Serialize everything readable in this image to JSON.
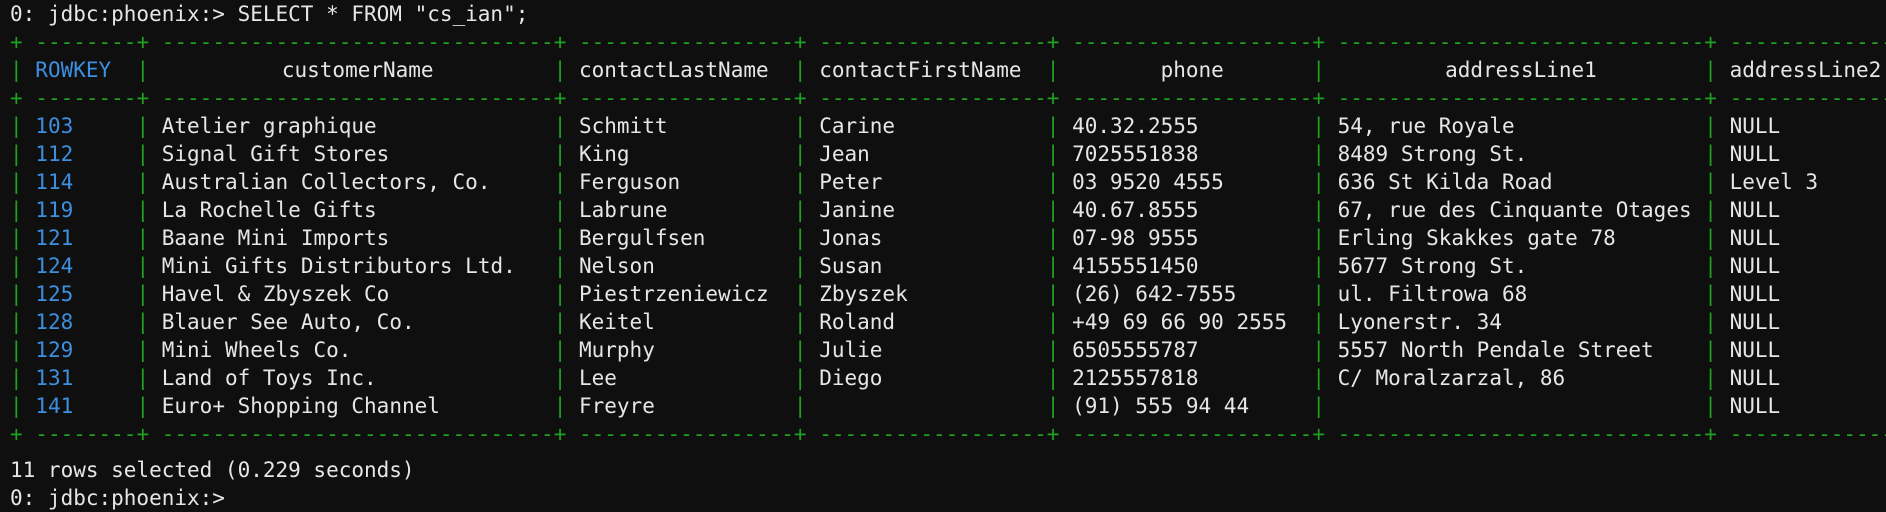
{
  "prompt": {
    "command_line": "0: jdbc:phoenix:> SELECT * FROM \"cs_ian\";",
    "final_prompt": "0: jdbc:phoenix:>"
  },
  "table": {
    "columns": [
      "ROWKEY",
      "customerName",
      "contactLastName",
      "contactFirstName",
      "phone",
      "addressLine1",
      "addressLine2"
    ],
    "rows": [
      [
        "103",
        "Atelier graphique",
        "Schmitt",
        "Carine",
        "40.32.2555",
        "54, rue Royale",
        "NULL"
      ],
      [
        "112",
        "Signal Gift Stores",
        "King",
        "Jean",
        "7025551838",
        "8489 Strong St.",
        "NULL"
      ],
      [
        "114",
        "Australian Collectors, Co.",
        "Ferguson",
        "Peter",
        "03 9520 4555",
        "636 St Kilda Road",
        "Level 3"
      ],
      [
        "119",
        "La Rochelle Gifts",
        "Labrune",
        "Janine",
        "40.67.8555",
        "67, rue des Cinquante Otages",
        "NULL"
      ],
      [
        "121",
        "Baane Mini Imports",
        "Bergulfsen",
        "Jonas",
        "07-98 9555",
        "Erling Skakkes gate 78",
        "NULL"
      ],
      [
        "124",
        "Mini Gifts Distributors Ltd.",
        "Nelson",
        "Susan",
        "4155551450",
        "5677 Strong St.",
        "NULL"
      ],
      [
        "125",
        "Havel & Zbyszek Co",
        "Piestrzeniewicz",
        "Zbyszek",
        "(26) 642-7555",
        "ul. Filtrowa 68",
        "NULL"
      ],
      [
        "128",
        "Blauer See Auto, Co.",
        "Keitel",
        "Roland",
        "+49 69 66 90 2555",
        "Lyonerstr. 34",
        "NULL"
      ],
      [
        "129",
        "Mini Wheels Co.",
        "Murphy",
        "Julie",
        "6505555787",
        "5557 North Pendale Street",
        "NULL"
      ],
      [
        "131",
        "Land of Toys Inc.",
        "Lee",
        "Diego",
        "2125557818",
        "C/ Moralzarzal, 86",
        "NULL"
      ],
      [
        "141",
        "Euro+ Shopping Channel",
        "Freyre",
        "",
        "(91) 555 94 44",
        "",
        "NULL"
      ]
    ]
  },
  "result": {
    "summary": "11 rows selected (0.229 seconds)"
  },
  "colors": {
    "background": "#0f0f0f",
    "border": "#1fa01f",
    "rowkey": "#3d8fe0",
    "text": "#e6e6e6"
  }
}
